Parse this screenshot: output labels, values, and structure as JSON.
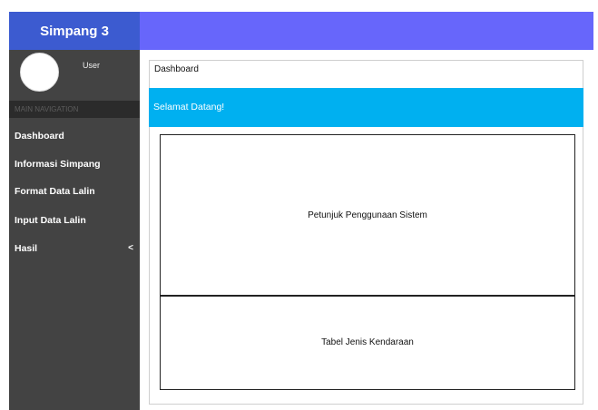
{
  "header": {
    "brand": "Simpang 3"
  },
  "sidebar": {
    "user_name": "User",
    "nav_header": "MAIN NAVIGATION",
    "items": [
      {
        "label": "Dashboard"
      },
      {
        "label": "Informasi Simpang"
      },
      {
        "label": "Format Data Lalin"
      },
      {
        "label": "Input Data Lalin"
      },
      {
        "label": "Hasil",
        "arrow": "<"
      }
    ]
  },
  "main": {
    "breadcrumb": "Dashboard",
    "welcome": "Selamat Datang!",
    "panels": [
      {
        "title": "Petunjuk Penggunaan Sistem"
      },
      {
        "title": "Tabel Jenis Kendaraan"
      }
    ]
  },
  "colors": {
    "brand_bg": "#3c5bd0",
    "topbar_bg": "#6766fb",
    "sidebar_bg": "#434343",
    "nav_header_bg": "#2b2b2b",
    "welcome_bg": "#00b0f0"
  }
}
